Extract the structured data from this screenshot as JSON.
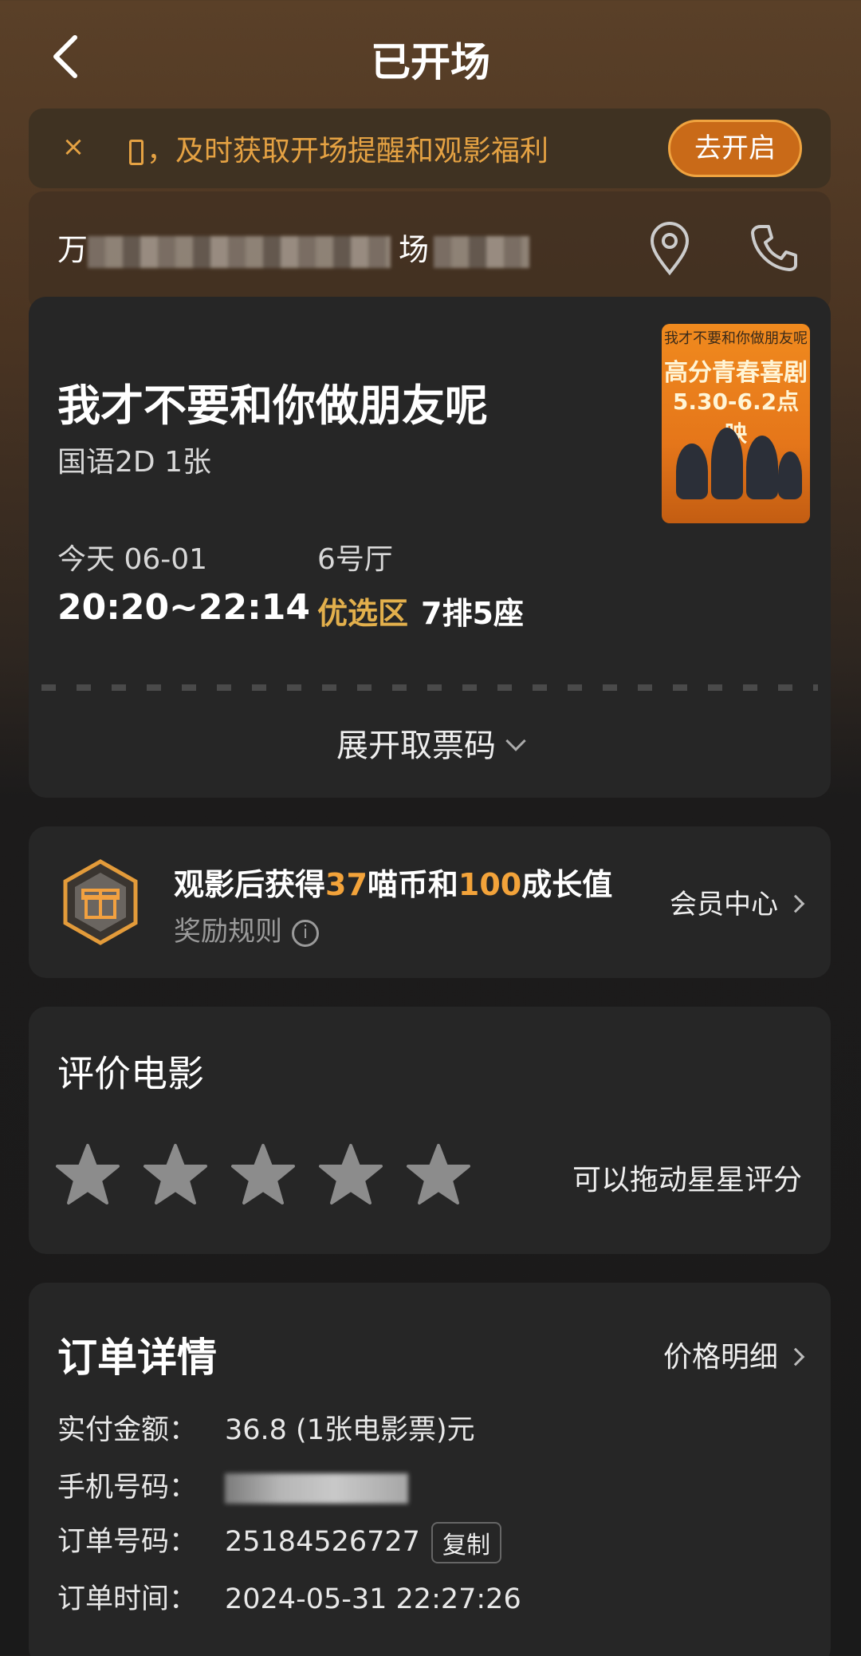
{
  "header": {
    "title": "已开场"
  },
  "notice": {
    "text": "，及时获取开场提醒和观影福利",
    "button": "去开启"
  },
  "cinema": {
    "name_visible_prefix": "万",
    "name_visible_suffix": "场"
  },
  "ticket": {
    "movie_title": "我才不要和你做朋友呢",
    "spec": "国语2D 1张",
    "date": "今天 06-01",
    "time": "20:20~22:14",
    "hall": "6号厅",
    "zone": "优选区",
    "seat": "7排5座",
    "expand_label": "展开取票码",
    "poster": {
      "line1": "高分青春喜剧",
      "line2": "5.30-6.2点映"
    }
  },
  "reward": {
    "prefix": "观影后获得",
    "coins": "37",
    "mid": "喵币和",
    "growth": "100",
    "suffix": "成长值",
    "rule_label": "奖励规则",
    "member_link": "会员中心"
  },
  "rating": {
    "title": "评价电影",
    "hint": "可以拖动星星评分",
    "stars_total": 5,
    "stars_selected": 0
  },
  "order": {
    "title": "订单详情",
    "price_link": "价格明细",
    "paid_label": "实付金额：",
    "paid_value": "36.8 (1张电影票)元",
    "phone_label": "手机号码：",
    "order_no_label": "订单号码：",
    "order_no_value": "25184526727",
    "copy_label": "复制",
    "time_label": "订单时间：",
    "time_value": "2024-05-31 22:27:26"
  },
  "colors": {
    "accent_orange": "#f3a33a",
    "zone_gold": "#e3b04c",
    "card_bg": "#262626"
  },
  "icons": [
    "back-arrow-icon",
    "close-icon",
    "location-pin-icon",
    "phone-icon",
    "chevron-down-icon",
    "gift-badge-icon",
    "info-icon",
    "chevron-right-icon",
    "star-icon"
  ]
}
